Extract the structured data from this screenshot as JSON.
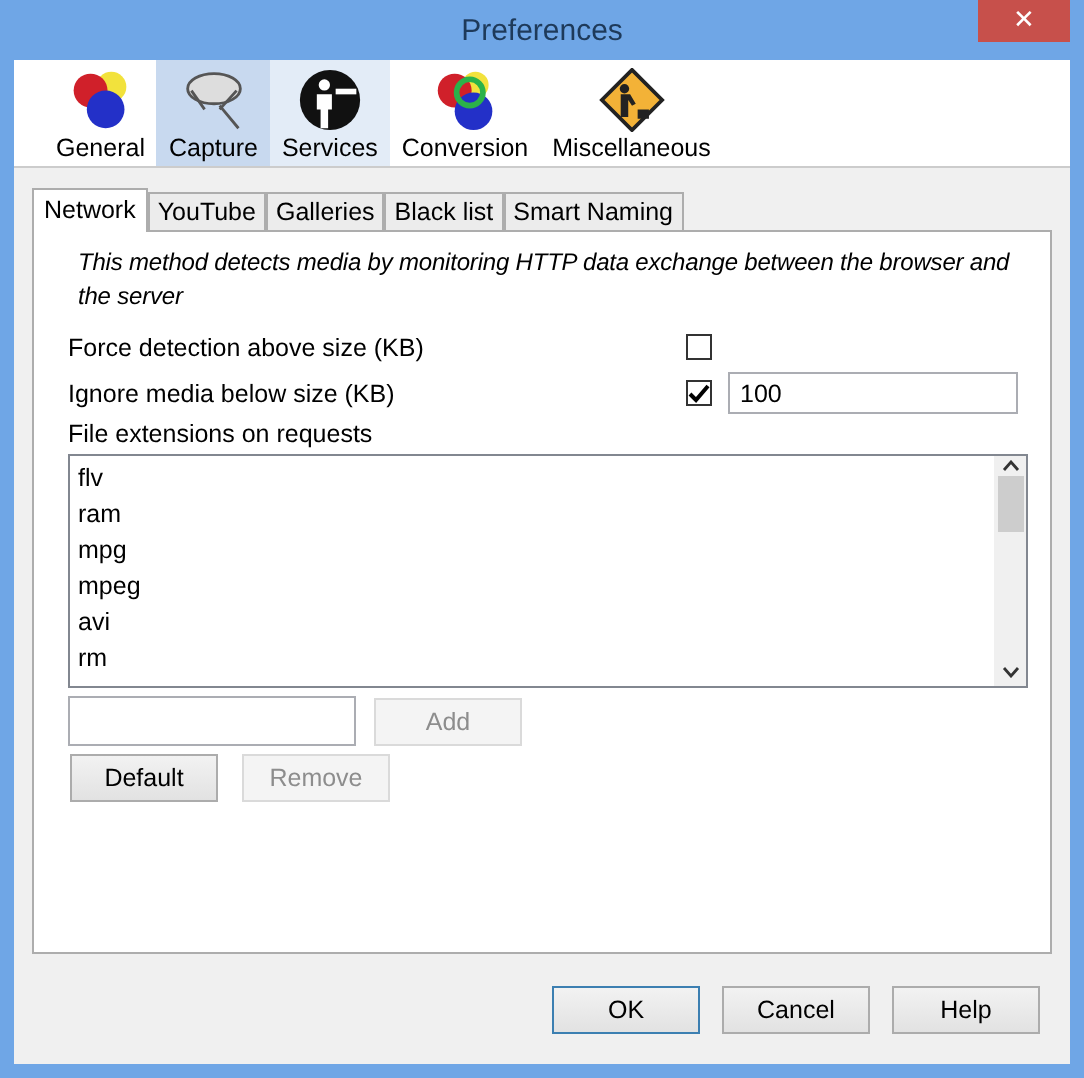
{
  "window": {
    "title": "Preferences",
    "close": "✕"
  },
  "categories": [
    {
      "label": "General",
      "kind": "general",
      "selected": false,
      "hovered": false
    },
    {
      "label": "Capture",
      "kind": "capture",
      "selected": true,
      "hovered": false
    },
    {
      "label": "Services",
      "kind": "services",
      "selected": false,
      "hovered": true
    },
    {
      "label": "Conversion",
      "kind": "conversion",
      "selected": false,
      "hovered": false
    },
    {
      "label": "Miscellaneous",
      "kind": "misc",
      "selected": false,
      "hovered": false
    }
  ],
  "tabs": [
    {
      "label": "Network",
      "selected": true
    },
    {
      "label": "YouTube",
      "selected": false
    },
    {
      "label": "Galleries",
      "selected": false
    },
    {
      "label": "Black list",
      "selected": false
    },
    {
      "label": "Smart Naming",
      "selected": false
    }
  ],
  "description": "This method detects media by monitoring HTTP data exchange between the browser and the server",
  "options": [
    {
      "label": "Force detection above size (KB)",
      "checked": false
    },
    {
      "label": "Ignore media below size (KB)",
      "checked": true,
      "value": "100"
    }
  ],
  "extensions": {
    "label": "File extensions on requests",
    "items": [
      "flv",
      "ram",
      "mpg",
      "mpeg",
      "avi",
      "rm"
    ]
  },
  "list_buttons": [
    {
      "label": "Add",
      "disabled": true
    },
    {
      "label": "Default",
      "disabled": false
    },
    {
      "label": "Remove",
      "disabled": true
    }
  ],
  "dialog_buttons": [
    {
      "label": "OK",
      "default": true
    },
    {
      "label": "Cancel",
      "default": false
    },
    {
      "label": "Help",
      "default": false
    }
  ]
}
